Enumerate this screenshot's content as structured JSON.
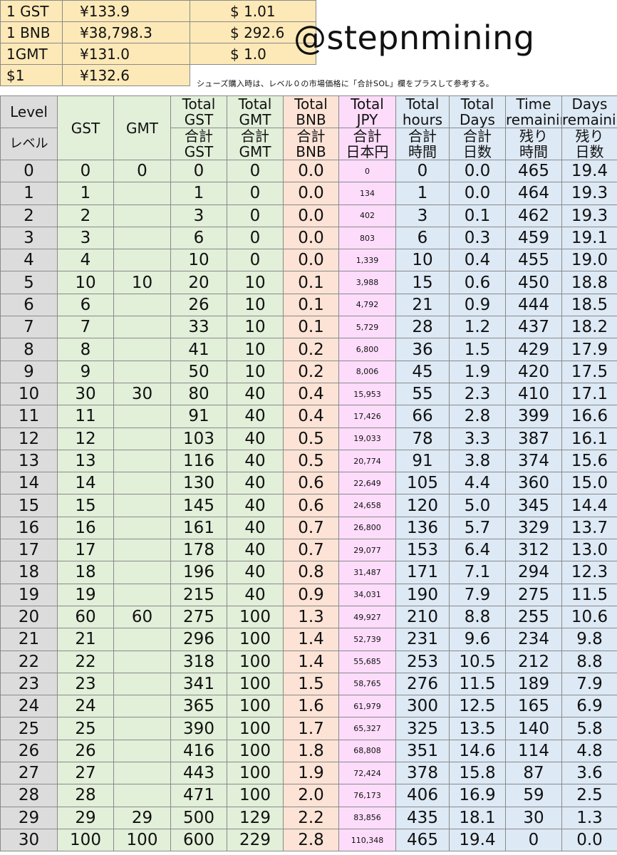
{
  "rates": [
    {
      "label": "1 GST",
      "jpy": "¥133.9",
      "usd": "$  1.01"
    },
    {
      "label": "1 BNB",
      "jpy": "¥38,798.3",
      "usd": "$  292.6"
    },
    {
      "label": "1GMT",
      "jpy": "¥131.0",
      "usd": "$  1.0"
    },
    {
      "label": "$1",
      "jpy": "¥132.6",
      "usd": ""
    }
  ],
  "handle": "@stepnmining",
  "note": "シューズ購入時は、レベル０の市場価格に「合計SOL」欄をプラスして参考する。",
  "headers": {
    "level_en": "Level",
    "level_ja": "レベル",
    "gst": "GST",
    "gmt": "GMT",
    "total_gst_en": "Total GST",
    "total_gst_ja": "合計 GST",
    "total_gmt_en": "Total GMT",
    "total_gmt_ja": "合計 GMT",
    "total_bnb_en": "Total BNB",
    "total_bnb_ja": "合計 BNB",
    "total_jpy_en": "Total JPY",
    "total_jpy_ja": "合計 日本円",
    "total_hours_en": "Total hours",
    "total_hours_ja": "合計 時間",
    "total_days_en": "Total Days",
    "total_days_ja": "合計 日数",
    "time_rem_en": "Time remaining",
    "time_rem_ja": "残り 時間",
    "days_rem_en": "Days remaining",
    "days_rem_ja": "残り 日数"
  },
  "rows": [
    [
      "0",
      "0",
      "0",
      "0",
      "0",
      "0.0",
      "0",
      "0",
      "0.0",
      "465",
      "19.4"
    ],
    [
      "1",
      "1",
      "",
      "1",
      "0",
      "0.0",
      "134",
      "1",
      "0.0",
      "464",
      "19.3"
    ],
    [
      "2",
      "2",
      "",
      "3",
      "0",
      "0.0",
      "402",
      "3",
      "0.1",
      "462",
      "19.3"
    ],
    [
      "3",
      "3",
      "",
      "6",
      "0",
      "0.0",
      "803",
      "6",
      "0.3",
      "459",
      "19.1"
    ],
    [
      "4",
      "4",
      "",
      "10",
      "0",
      "0.0",
      "1,339",
      "10",
      "0.4",
      "455",
      "19.0"
    ],
    [
      "5",
      "10",
      "10",
      "20",
      "10",
      "0.1",
      "3,988",
      "15",
      "0.6",
      "450",
      "18.8"
    ],
    [
      "6",
      "6",
      "",
      "26",
      "10",
      "0.1",
      "4,792",
      "21",
      "0.9",
      "444",
      "18.5"
    ],
    [
      "7",
      "7",
      "",
      "33",
      "10",
      "0.1",
      "5,729",
      "28",
      "1.2",
      "437",
      "18.2"
    ],
    [
      "8",
      "8",
      "",
      "41",
      "10",
      "0.2",
      "6,800",
      "36",
      "1.5",
      "429",
      "17.9"
    ],
    [
      "9",
      "9",
      "",
      "50",
      "10",
      "0.2",
      "8,006",
      "45",
      "1.9",
      "420",
      "17.5"
    ],
    [
      "10",
      "30",
      "30",
      "80",
      "40",
      "0.4",
      "15,953",
      "55",
      "2.3",
      "410",
      "17.1"
    ],
    [
      "11",
      "11",
      "",
      "91",
      "40",
      "0.4",
      "17,426",
      "66",
      "2.8",
      "399",
      "16.6"
    ],
    [
      "12",
      "12",
      "",
      "103",
      "40",
      "0.5",
      "19,033",
      "78",
      "3.3",
      "387",
      "16.1"
    ],
    [
      "13",
      "13",
      "",
      "116",
      "40",
      "0.5",
      "20,774",
      "91",
      "3.8",
      "374",
      "15.6"
    ],
    [
      "14",
      "14",
      "",
      "130",
      "40",
      "0.6",
      "22,649",
      "105",
      "4.4",
      "360",
      "15.0"
    ],
    [
      "15",
      "15",
      "",
      "145",
      "40",
      "0.6",
      "24,658",
      "120",
      "5.0",
      "345",
      "14.4"
    ],
    [
      "16",
      "16",
      "",
      "161",
      "40",
      "0.7",
      "26,800",
      "136",
      "5.7",
      "329",
      "13.7"
    ],
    [
      "17",
      "17",
      "",
      "178",
      "40",
      "0.7",
      "29,077",
      "153",
      "6.4",
      "312",
      "13.0"
    ],
    [
      "18",
      "18",
      "",
      "196",
      "40",
      "0.8",
      "31,487",
      "171",
      "7.1",
      "294",
      "12.3"
    ],
    [
      "19",
      "19",
      "",
      "215",
      "40",
      "0.9",
      "34,031",
      "190",
      "7.9",
      "275",
      "11.5"
    ],
    [
      "20",
      "60",
      "60",
      "275",
      "100",
      "1.3",
      "49,927",
      "210",
      "8.8",
      "255",
      "10.6"
    ],
    [
      "21",
      "21",
      "",
      "296",
      "100",
      "1.4",
      "52,739",
      "231",
      "9.6",
      "234",
      "9.8"
    ],
    [
      "22",
      "22",
      "",
      "318",
      "100",
      "1.4",
      "55,685",
      "253",
      "10.5",
      "212",
      "8.8"
    ],
    [
      "23",
      "23",
      "",
      "341",
      "100",
      "1.5",
      "58,765",
      "276",
      "11.5",
      "189",
      "7.9"
    ],
    [
      "24",
      "24",
      "",
      "365",
      "100",
      "1.6",
      "61,979",
      "300",
      "12.5",
      "165",
      "6.9"
    ],
    [
      "25",
      "25",
      "",
      "390",
      "100",
      "1.7",
      "65,327",
      "325",
      "13.5",
      "140",
      "5.8"
    ],
    [
      "26",
      "26",
      "",
      "416",
      "100",
      "1.8",
      "68,808",
      "351",
      "14.6",
      "114",
      "4.8"
    ],
    [
      "27",
      "27",
      "",
      "443",
      "100",
      "1.9",
      "72,424",
      "378",
      "15.8",
      "87",
      "3.6"
    ],
    [
      "28",
      "28",
      "",
      "471",
      "100",
      "2.0",
      "76,173",
      "406",
      "16.9",
      "59",
      "2.5"
    ],
    [
      "29",
      "29",
      "29",
      "500",
      "129",
      "2.2",
      "83,856",
      "435",
      "18.1",
      "30",
      "1.3"
    ],
    [
      "30",
      "100",
      "100",
      "600",
      "229",
      "2.8",
      "110,348",
      "465",
      "19.4",
      "0",
      "0.0"
    ]
  ]
}
